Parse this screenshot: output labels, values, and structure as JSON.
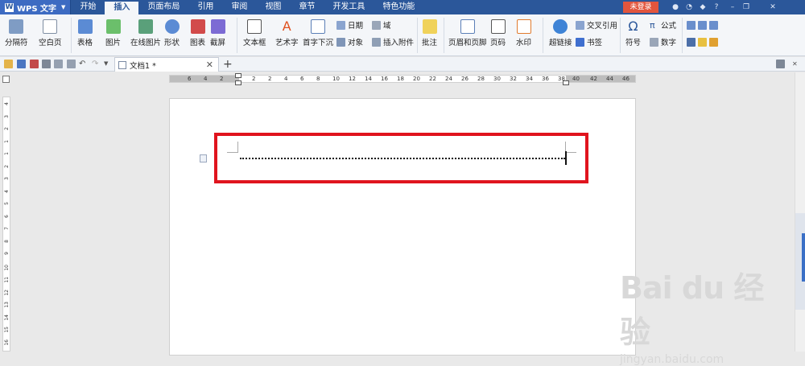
{
  "app": {
    "name": "WPS 文字"
  },
  "menu_tabs": [
    "开始",
    "插入",
    "页面布局",
    "引用",
    "审阅",
    "视图",
    "章节",
    "开发工具",
    "特色功能"
  ],
  "active_tab": "插入",
  "login_label": "未登录",
  "ribbon": {
    "page_break": "分隔符",
    "blank_page": "空白页",
    "table": "表格",
    "picture": "图片",
    "online_picture": "在线图片",
    "shape": "形状",
    "chart": "图表",
    "screenshot": "截屏",
    "textbox": "文本框",
    "wordart": "艺术字",
    "dropcap": "首字下沉",
    "date": "日期",
    "field": "域",
    "object": "对象",
    "attachment": "插入附件",
    "comment": "批注",
    "header_footer": "页眉和页脚",
    "page_number": "页码",
    "watermark": "水印",
    "hyperlink": "超链接",
    "crossref": "交叉引用",
    "bookmark": "书签",
    "symbol": "符号",
    "formula": "公式",
    "number": "数字"
  },
  "doc_tab": {
    "title": "文档1 *"
  },
  "ruler_top_labels": [
    "6",
    "4",
    "2",
    "2",
    "2",
    "4",
    "6",
    "8",
    "10",
    "12",
    "14",
    "16",
    "18",
    "20",
    "22",
    "24",
    "26",
    "28",
    "30",
    "32",
    "34",
    "36",
    "38",
    "40",
    "42",
    "44",
    "46"
  ],
  "ruler_left_labels": [
    "4",
    "3",
    "2",
    "1",
    "1",
    "2",
    "3",
    "4",
    "5",
    "6",
    "7",
    "8",
    "9",
    "10",
    "11",
    "12",
    "13",
    "14",
    "15",
    "16"
  ],
  "watermark": {
    "big": "Bai du 经验",
    "small": "jingyan.baidu.com"
  }
}
